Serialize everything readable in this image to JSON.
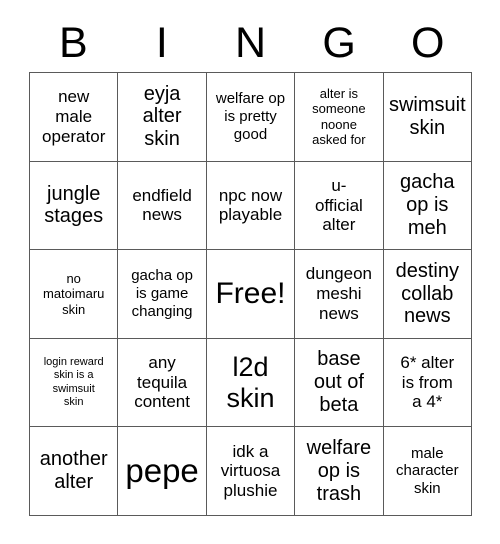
{
  "card": {
    "type": "bingo-card",
    "background_color": "#ffffff",
    "text_color": "#000000",
    "border_color": "#5a5a5a",
    "columns": 5,
    "rows": 5
  },
  "header": {
    "letters": [
      {
        "label": "B"
      },
      {
        "label": "I"
      },
      {
        "label": "N"
      },
      {
        "label": "G"
      },
      {
        "label": "O"
      }
    ]
  },
  "grid": {
    "cells": [
      {
        "text": "new\nmale\noperator",
        "size": "fs-l",
        "free": false
      },
      {
        "text": "eyja\nalter\nskin",
        "size": "fs-xl",
        "free": false
      },
      {
        "text": "welfare op\nis pretty\ngood",
        "size": "fs-m",
        "free": false
      },
      {
        "text": "alter is\nsomeone\nnoone\nasked for",
        "size": "fs-s",
        "free": false
      },
      {
        "text": "swimsuit\nskin",
        "size": "fs-xl",
        "free": false
      },
      {
        "text": "jungle\nstages",
        "size": "fs-xl",
        "free": false
      },
      {
        "text": "endfield\nnews",
        "size": "fs-l",
        "free": false
      },
      {
        "text": "npc now\nplayable",
        "size": "fs-l",
        "free": false
      },
      {
        "text": "u-\nofficial\nalter",
        "size": "fs-l",
        "free": false
      },
      {
        "text": "gacha\nop is\nmeh",
        "size": "fs-xl",
        "free": false
      },
      {
        "text": "no\nmatoimaru\nskin",
        "size": "fs-s",
        "free": false
      },
      {
        "text": "gacha op\nis game\nchanging",
        "size": "fs-m",
        "free": false
      },
      {
        "text": "Free!",
        "size": "fs-huge",
        "free": true
      },
      {
        "text": "dungeon\nmeshi\nnews",
        "size": "fs-l",
        "free": false
      },
      {
        "text": "destiny\ncollab\nnews",
        "size": "fs-xl",
        "free": false
      },
      {
        "text": "login reward\nskin is a\nswimsuit\nskin",
        "size": "fs-xs",
        "free": false
      },
      {
        "text": "any\ntequila\ncontent",
        "size": "fs-l",
        "free": false
      },
      {
        "text": "l2d\nskin",
        "size": "fs-xxl",
        "free": false
      },
      {
        "text": "base\nout of\nbeta",
        "size": "fs-xl",
        "free": false
      },
      {
        "text": "6* alter\nis from\na 4*",
        "size": "fs-l",
        "free": false
      },
      {
        "text": "another\nalter",
        "size": "fs-xl",
        "free": false
      },
      {
        "text": "pepe",
        "size": "fs-mega",
        "free": false
      },
      {
        "text": "idk a\nvirtuosa\nplushie",
        "size": "fs-l",
        "free": false
      },
      {
        "text": "welfare\nop is\ntrash",
        "size": "fs-xl",
        "free": false
      },
      {
        "text": "male\ncharacter\nskin",
        "size": "fs-m",
        "free": false
      }
    ]
  }
}
